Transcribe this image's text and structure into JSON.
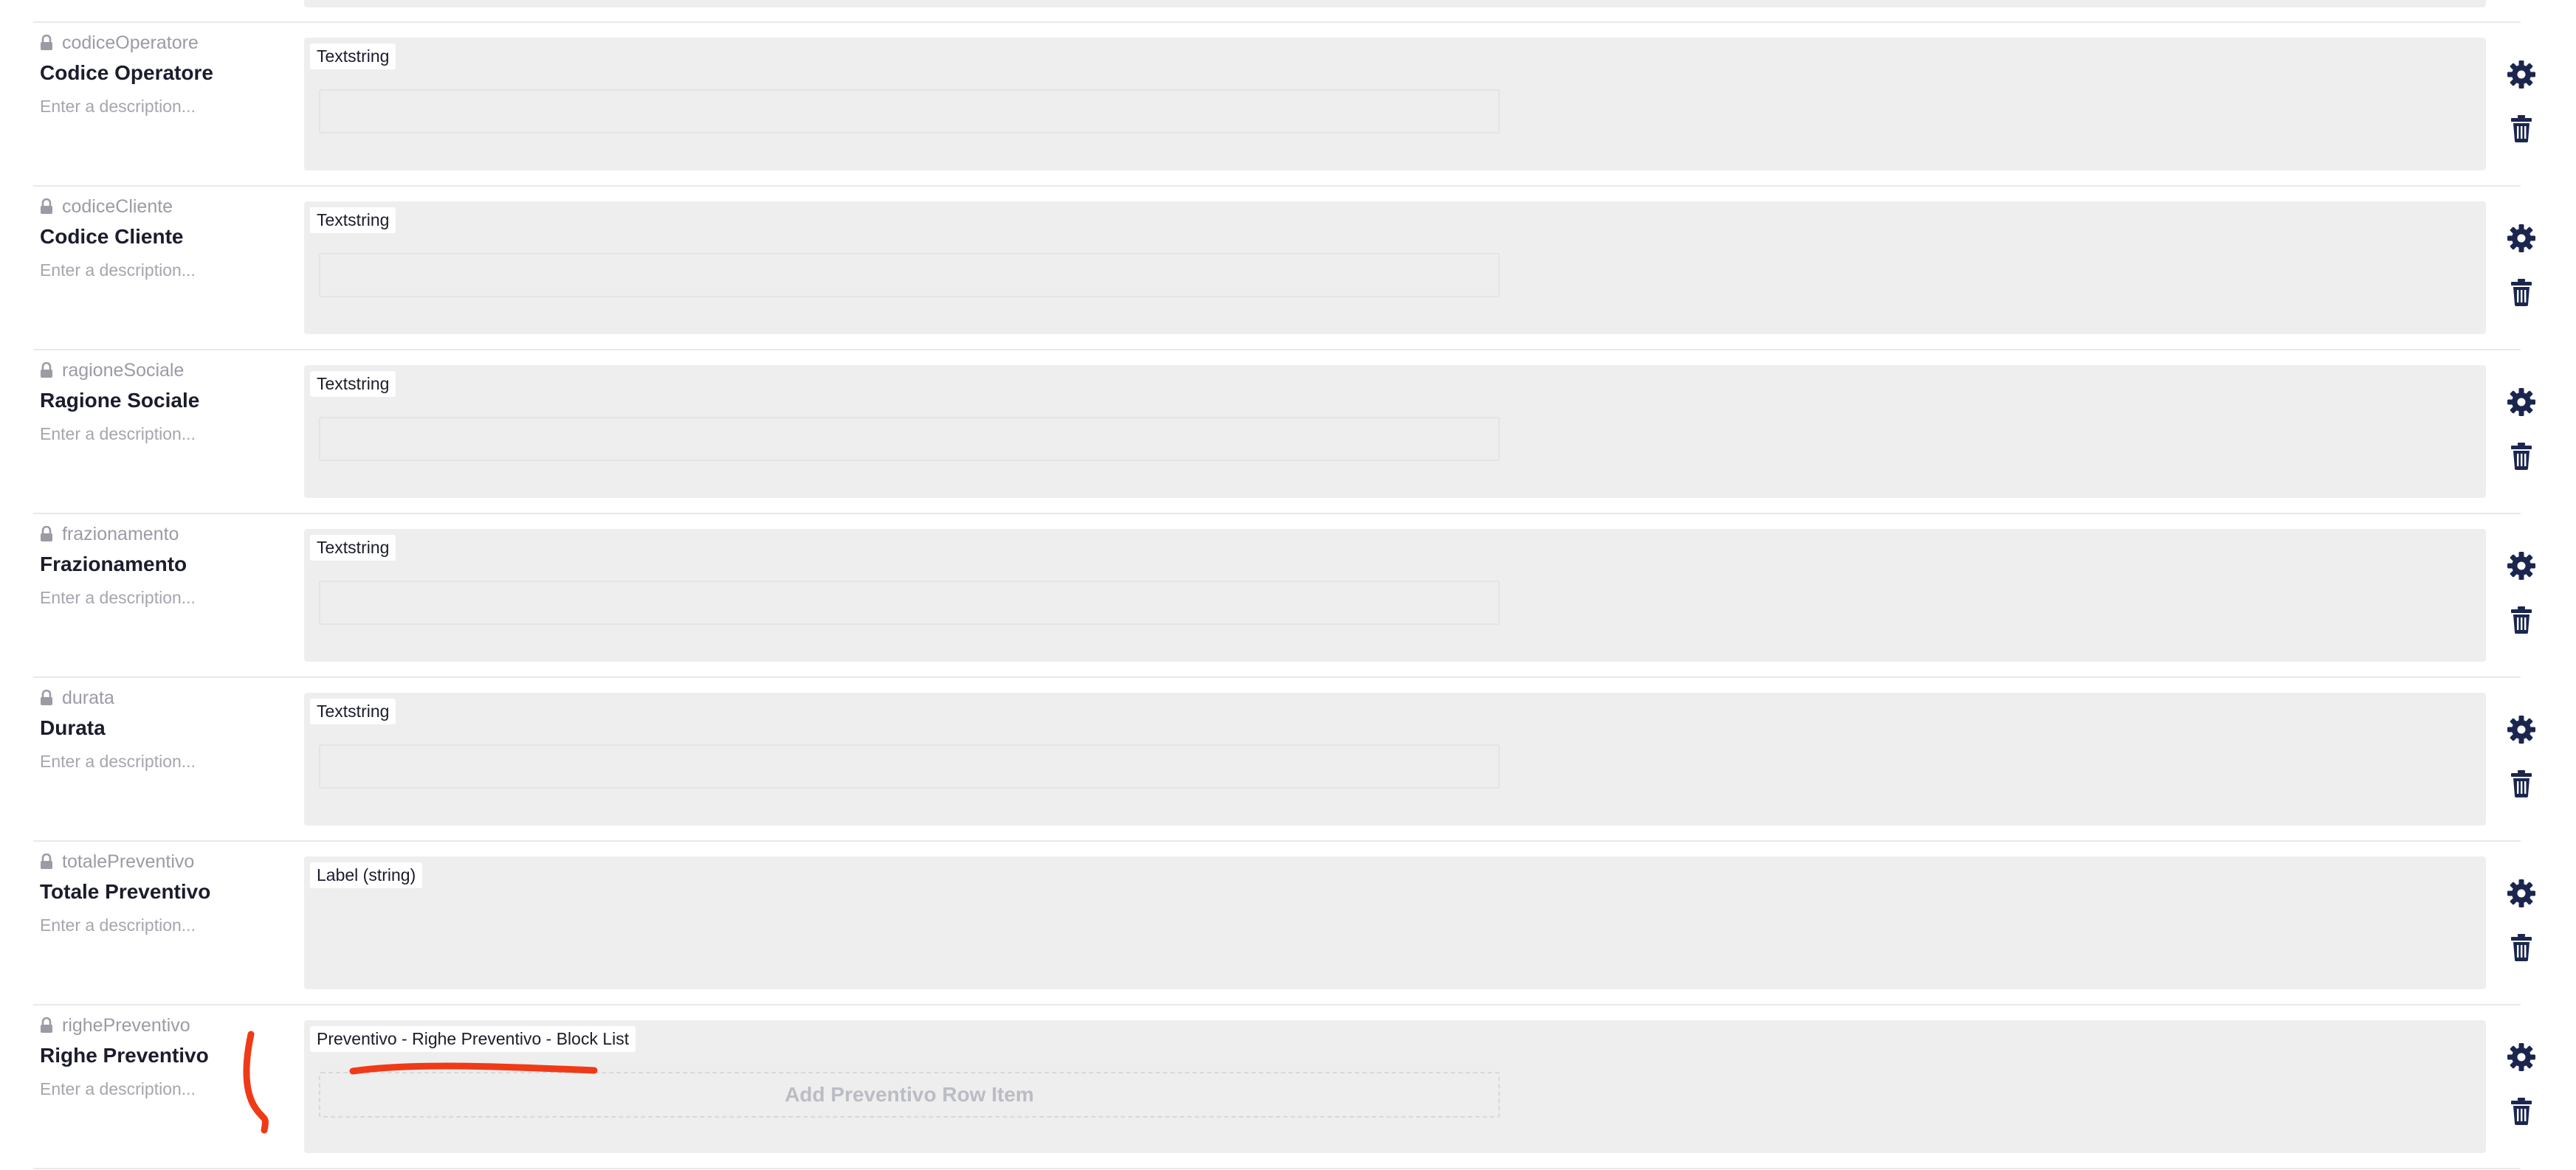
{
  "colors": {
    "editor_background": "#eeeeee",
    "icon": "#1b264f",
    "alias_text": "#9a9ba5",
    "annotation": "#f03a17"
  },
  "properties": [
    {
      "alias": "codiceOperatore",
      "label": "Codice Operatore",
      "description_placeholder": "Enter a description...",
      "editor": "Textstring",
      "kind": "textstring"
    },
    {
      "alias": "codiceCliente",
      "label": "Codice Cliente",
      "description_placeholder": "Enter a description...",
      "editor": "Textstring",
      "kind": "textstring"
    },
    {
      "alias": "ragioneSociale",
      "label": "Ragione Sociale",
      "description_placeholder": "Enter a description...",
      "editor": "Textstring",
      "kind": "textstring"
    },
    {
      "alias": "frazionamento",
      "label": "Frazionamento",
      "description_placeholder": "Enter a description...",
      "editor": "Textstring",
      "kind": "textstring"
    },
    {
      "alias": "durata",
      "label": "Durata",
      "description_placeholder": "Enter a description...",
      "editor": "Textstring",
      "kind": "textstring"
    },
    {
      "alias": "totalePreventivo",
      "label": "Totale Preventivo",
      "description_placeholder": "Enter a description...",
      "editor": "Label (string)",
      "kind": "label"
    },
    {
      "alias": "righePreventivo",
      "label": "Righe Preventivo",
      "description_placeholder": "Enter a description...",
      "editor": "Preventivo - Righe Preventivo - Block List",
      "kind": "blocklist",
      "add_button_label": "Add Preventivo Row Item"
    }
  ],
  "icons": {
    "lock": "lock-icon",
    "settings": "gear-icon",
    "delete": "trash-icon"
  }
}
